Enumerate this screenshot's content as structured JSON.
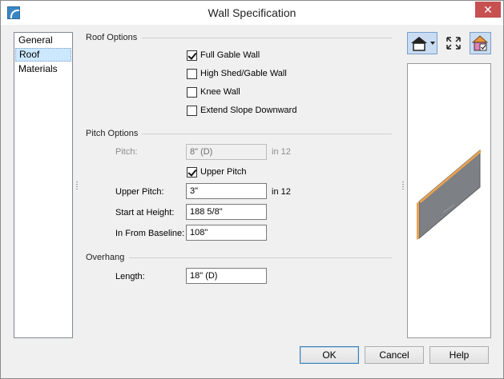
{
  "window": {
    "title": "Wall Specification"
  },
  "nav": {
    "items": [
      "General",
      "Roof",
      "Materials"
    ],
    "selected": "Roof"
  },
  "roof_options": {
    "heading": "Roof Options",
    "full_gable_wall": {
      "label": "Full Gable Wall",
      "checked": true
    },
    "high_shed_gable_wall": {
      "label": "High Shed/Gable Wall",
      "checked": false
    },
    "knee_wall": {
      "label": "Knee Wall",
      "checked": false
    },
    "extend_slope_downward": {
      "label": "Extend Slope Downward",
      "checked": false
    }
  },
  "pitch_options": {
    "heading": "Pitch Options",
    "pitch": {
      "label": "Pitch:",
      "value": "8\" (D)",
      "unit": "in 12",
      "disabled": true
    },
    "upper_pitch_toggle": {
      "label": "Upper Pitch",
      "checked": true
    },
    "upper_pitch": {
      "label": "Upper Pitch:",
      "value": "3\"",
      "unit": "in 12"
    },
    "start_at_height": {
      "label": "Start at Height:",
      "value": "188 5/8\""
    },
    "in_from_baseline": {
      "label": "In From Baseline:",
      "value": "108\""
    }
  },
  "overhang": {
    "heading": "Overhang",
    "length": {
      "label": "Length:",
      "value": "18\" (D)"
    }
  },
  "preview_toolbar": {
    "camera_icon": "house-camera-icon",
    "fit_icon": "fit-to-window-icon",
    "materials_icon": "colored-house-icon"
  },
  "colors": {
    "wall_face": "#7d8085",
    "wall_edge": "#e9a24f",
    "accent": "#3c7fb1"
  },
  "buttons": {
    "ok": "OK",
    "cancel": "Cancel",
    "help": "Help"
  }
}
